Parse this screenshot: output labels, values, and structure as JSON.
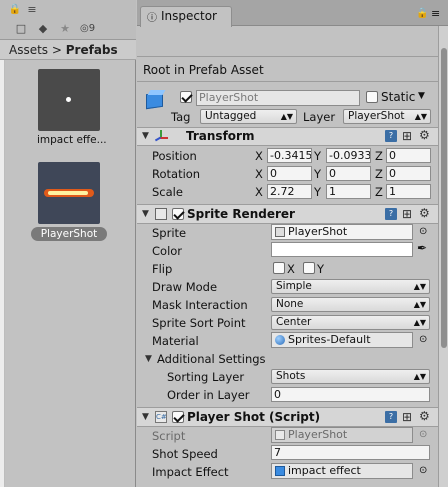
{
  "project": {
    "toolbar": {
      "eye_count": "9"
    },
    "breadcrumb": {
      "root": "Assets",
      "current": "Prefabs"
    },
    "assets": [
      {
        "label": "impact effe..."
      },
      {
        "label": "PlayerShot"
      }
    ]
  },
  "inspector": {
    "tab_title": "Inspector",
    "prefab_note": "Root in Prefab Asset",
    "object": {
      "name": "PlayerShot",
      "static_label": "Static",
      "tag_label": "Tag",
      "tag_value": "Untagged",
      "layer_label": "Layer",
      "layer_value": "PlayerShot"
    },
    "transform": {
      "title": "Transform",
      "position_label": "Position",
      "rotation_label": "Rotation",
      "scale_label": "Scale",
      "x": "X",
      "y": "Y",
      "z": "Z",
      "position": {
        "x": "-0.3415",
        "y": "-0.0933",
        "z": "0"
      },
      "rotation": {
        "x": "0",
        "y": "0",
        "z": "0"
      },
      "scale": {
        "x": "2.72",
        "y": "1",
        "z": "1"
      }
    },
    "sprite_renderer": {
      "title": "Sprite Renderer",
      "sprite_label": "Sprite",
      "sprite_value": "PlayerShot",
      "color_label": "Color",
      "flip_label": "Flip",
      "flip_x": "X",
      "flip_y": "Y",
      "draw_mode_label": "Draw Mode",
      "draw_mode_value": "Simple",
      "mask_label": "Mask Interaction",
      "mask_value": "None",
      "sort_point_label": "Sprite Sort Point",
      "sort_point_value": "Center",
      "material_label": "Material",
      "material_value": "Sprites-Default",
      "additional_label": "Additional Settings",
      "sorting_layer_label": "Sorting Layer",
      "sorting_layer_value": "Shots",
      "order_label": "Order in Layer",
      "order_value": "0"
    },
    "player_shot": {
      "title": "Player Shot (Script)",
      "script_label": "Script",
      "script_value": "PlayerShot",
      "speed_label": "Shot Speed",
      "speed_value": "7",
      "impact_label": "Impact Effect",
      "impact_value": "impact effect"
    }
  },
  "colors": {
    "inspector_bg": "#c2c2c2",
    "selection": "#7a7a7a",
    "script_icon": "#3b6ea5"
  }
}
